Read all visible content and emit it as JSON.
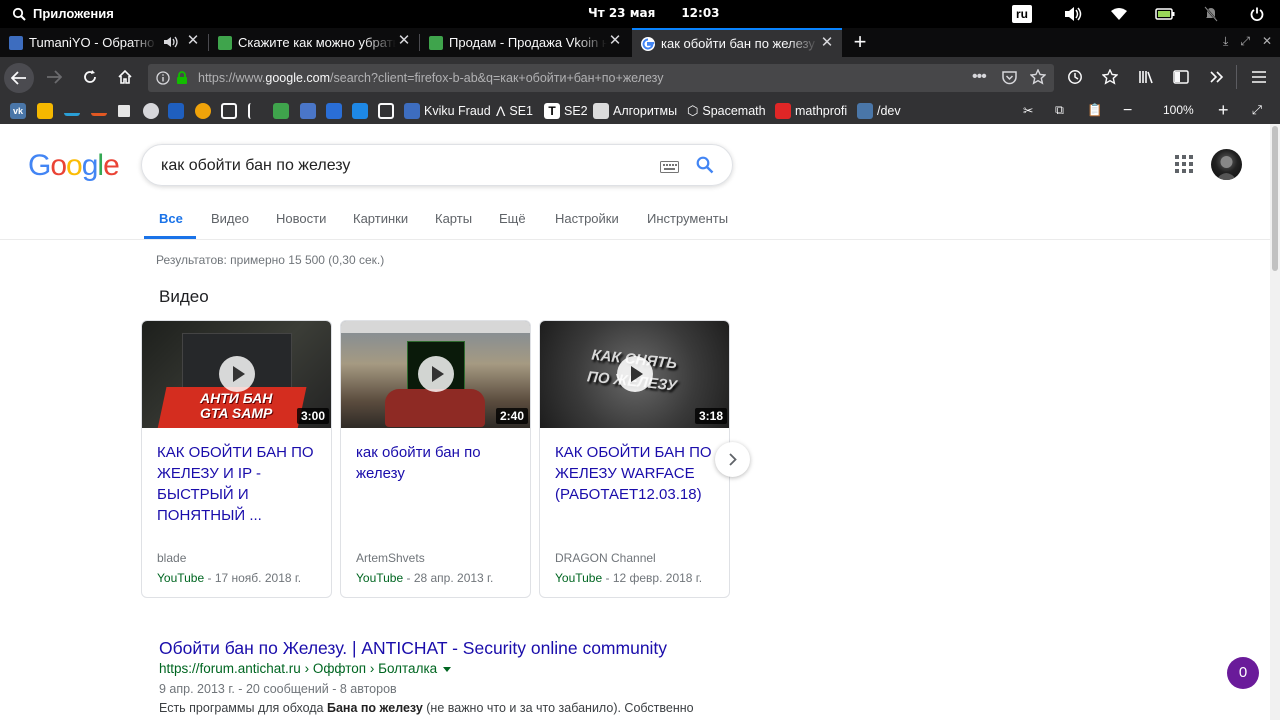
{
  "topbar": {
    "apps_label": "Приложения",
    "date": "Чт 23 мая",
    "time": "12:03",
    "lang": "ru"
  },
  "tabs": [
    {
      "title": "TumaniYO - Обратно",
      "favicon_color": "#3d6dbf"
    },
    {
      "title": "Скажите как можно убрать",
      "favicon_color": "#3fa44c"
    },
    {
      "title": "Продам - Продажа Vkoin не",
      "favicon_color": "#3fa44c"
    },
    {
      "title": "как обойти бан по железу",
      "favicon_color": "#ffffff"
    }
  ],
  "urlbar": {
    "prefix": "https://www.",
    "domain": "google.com",
    "rest": "/search?client=firefox-b-ab&q=как+обойти+бан+по+железу"
  },
  "bookmarks": {
    "items": [
      {
        "label": "Kviku Fraud",
        "icon_color": "#3d6dbf"
      },
      {
        "label": "SE1",
        "icon_color": "#323234"
      },
      {
        "label": "SE2",
        "icon_color": "#ffffff"
      },
      {
        "label": "Алгоритмы",
        "icon_color": "#dcdcdc"
      },
      {
        "label": "Spacemath",
        "icon_color": "#555555"
      },
      {
        "label": "mathprofi",
        "icon_color": "#e02626"
      },
      {
        "label": "/dev",
        "icon_color": "#4a76a8"
      }
    ],
    "zoom": "100%"
  },
  "search": {
    "query": "как обойти бан по железу",
    "tabs": [
      "Все",
      "Видео",
      "Новости",
      "Картинки",
      "Карты",
      "Ещё",
      "Настройки",
      "Инструменты"
    ],
    "stats": "Результатов: примерно 15 500 (0,30 сек.)"
  },
  "videos": {
    "heading": "Видео",
    "items": [
      {
        "title": "КАК ОБОЙТИ БАН ПО ЖЕЛЕЗУ И IP - БЫСТРЫЙ И ПОНЯТНЫЙ ...",
        "duration": "3:00",
        "channel": "blade",
        "source": "YouTube",
        "date": " - 17 нояб. 2018 г."
      },
      {
        "title": "как обойти бан по железу",
        "duration": "2:40",
        "channel": "ArtemShvets",
        "source": "YouTube",
        "date": " - 28 апр. 2013 г."
      },
      {
        "title": "КАК ОБОЙТИ БАН ПО ЖЕЛЕЗУ WARFACE (РАБОТАЕТ12.03.18)",
        "duration": "3:18",
        "channel": "DRAGON Channel",
        "source": "YouTube",
        "date": " - 12 февр. 2018 г."
      }
    ],
    "thumb_text": {
      "v1_line1": "АНТИ БАН",
      "v1_line2": "GTA SAMP",
      "v3_line1": "КАК СНЯТЬ",
      "v3_line2": "ПО ЖЕЛЕЗУ"
    }
  },
  "result1": {
    "title": "Обойти бан по Железу. | ANTICHAT - Security online community",
    "url": "https://forum.antichat.ru › Оффтоп › Болталка",
    "date": "9 апр. 2013 г. - 20 сообщений - 8 авторов",
    "snippet_pre": "Есть программы для обхода ",
    "snippet_bold": "Бана по железу",
    "snippet_post": " (не важно что и за что забанило). Собственно"
  },
  "notif_badge": "0"
}
